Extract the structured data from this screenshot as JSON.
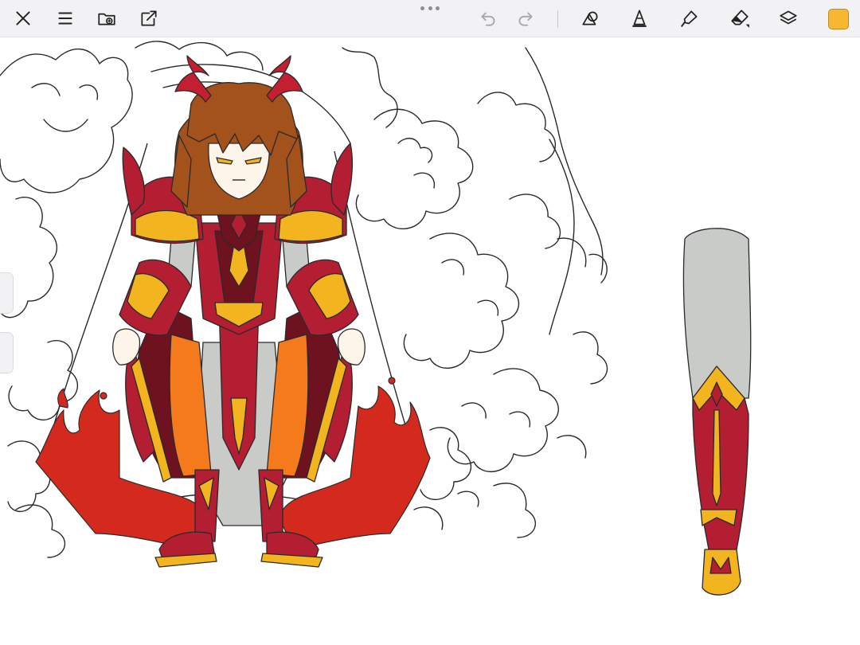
{
  "toolbar": {
    "left_tools": [
      "close-icon",
      "menu-icon",
      "gallery-icon",
      "export-icon"
    ],
    "history": [
      "undo-icon",
      "redo-icon"
    ],
    "right_tools": [
      "shapes-icon",
      "pen-icon",
      "lasso-icon",
      "eraser-icon",
      "layers-icon"
    ],
    "active_color": "#f7b733"
  },
  "palette": {
    "armor_red": "#b31e32",
    "armor_dark": "#6e1220",
    "gold": "#f2b51f",
    "flame_orange": "#f57a1c",
    "hair_brown": "#a4521c",
    "skin": "#fdf4ea",
    "undersuit_gray": "#c9cbc8",
    "lineart": "#2a2a2a"
  }
}
